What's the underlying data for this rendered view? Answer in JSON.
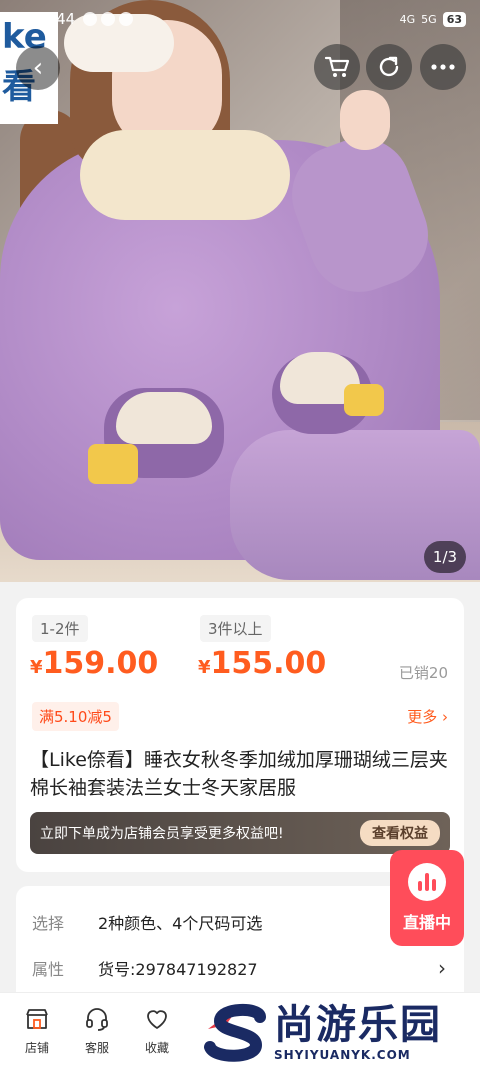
{
  "status_bar": {
    "time": "11:44",
    "battery": "63",
    "network": "4G",
    "signal": "5G"
  },
  "brand_tag": {
    "line1": "ke",
    "line2": "看"
  },
  "hero": {
    "page_indicator": "1/3"
  },
  "pricing": {
    "tiers": [
      {
        "qty": "1-2件",
        "symbol": "¥",
        "price": "159.00"
      },
      {
        "qty": "3件以上",
        "symbol": "¥",
        "price": "155.00"
      }
    ],
    "sold": "已销20",
    "promo": "满5.10减5",
    "more": "更多"
  },
  "product": {
    "title": "【Like倷看】睡衣女秋冬季加绒加厚珊瑚绒三层夹棉长袖套装法兰女士冬天家居服"
  },
  "member": {
    "text": "立即下单成为店铺会员享受更多权益吧!",
    "button": "查看权益"
  },
  "options": [
    {
      "label": "选择",
      "value": "2种颜色、4个尺码可选"
    },
    {
      "label": "属性",
      "value": "货号:297847192827"
    }
  ],
  "live": {
    "label": "直播中"
  },
  "bottom_nav": [
    {
      "label": "店铺",
      "icon": "shop-icon"
    },
    {
      "label": "客服",
      "icon": "headset-icon"
    },
    {
      "label": "收藏",
      "icon": "heart-icon"
    }
  ],
  "watermark": {
    "cn": "尚游乐园",
    "en": "SHYIYUANYK.COM"
  },
  "colors": {
    "accent": "#ff5c1f",
    "live": "#ff4d5a",
    "brand": "#1a2a63"
  }
}
